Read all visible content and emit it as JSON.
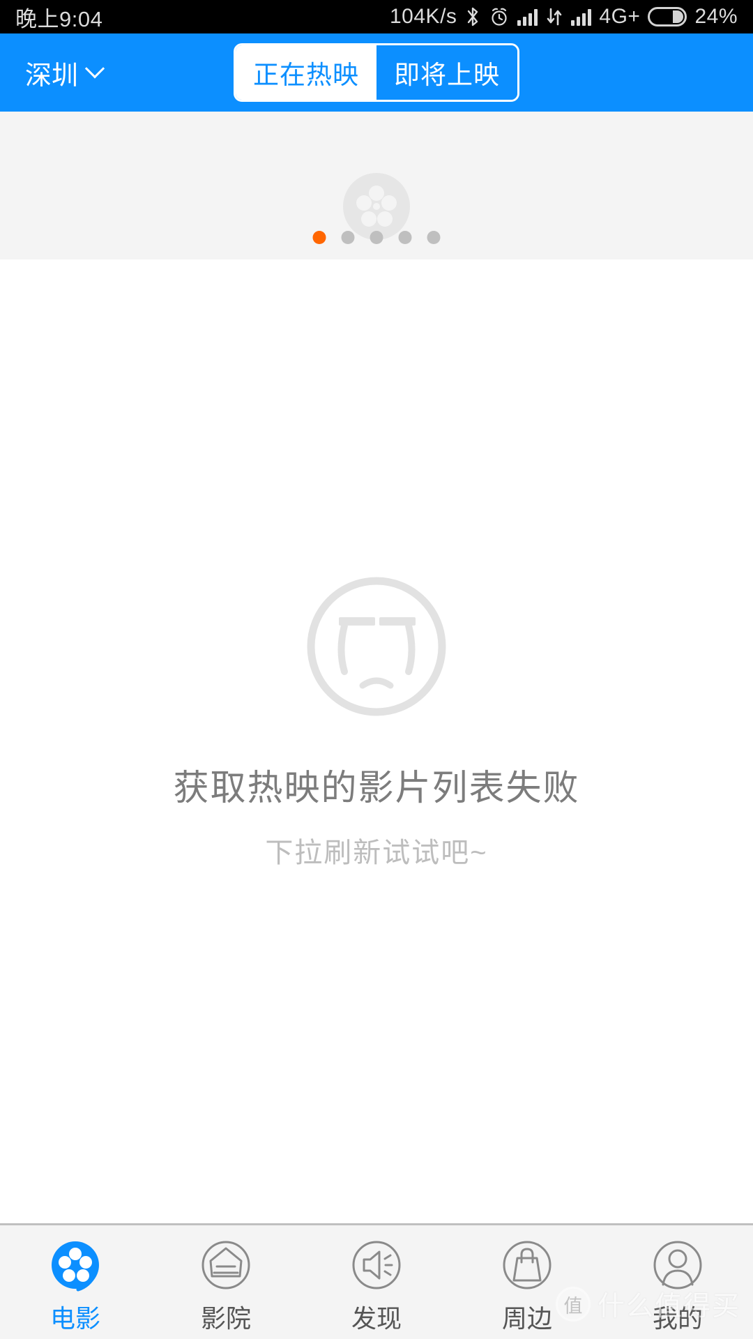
{
  "status_bar": {
    "clock": "晚上9:04",
    "net_speed": "104K/s",
    "bluetooth_icon": "bluetooth-icon",
    "alarm_icon": "alarm-clock-icon",
    "signal1_icon": "signal-bars-icon",
    "data_transfer_icon": "data-up-down-icon",
    "signal2_icon": "signal-bars-icon",
    "network_type": "4G+",
    "battery_icon": "battery-icon",
    "battery_percent": "24%"
  },
  "header": {
    "city": "深圳",
    "city_chevron_icon": "chevron-down-icon",
    "tabs": [
      {
        "label": "正在热映",
        "active": true
      },
      {
        "label": "即将上映",
        "active": false
      }
    ]
  },
  "banner": {
    "placeholder_icon": "film-reel-icon",
    "dot_count": 5,
    "active_dot_index": 0,
    "active_dot_color": "#FF6600",
    "inactive_dot_color": "#BFBFBF",
    "background_color": "#F4F4F4"
  },
  "empty_state": {
    "icon": "sad-face-icon",
    "title": "获取热映的影片列表失败",
    "subtitle": "下拉刷新试试吧~",
    "title_color": "#7C7C7C",
    "subtitle_color": "#BDBDBD"
  },
  "bottom_nav": {
    "active_color": "#0C8FFF",
    "inactive_color": "#555555",
    "items": [
      {
        "label": "电影",
        "icon": "film-reel-icon",
        "active": true
      },
      {
        "label": "影院",
        "icon": "cinema-seats-icon",
        "active": false
      },
      {
        "label": "发现",
        "icon": "megaphone-icon",
        "active": false
      },
      {
        "label": "周边",
        "icon": "shopping-bag-icon",
        "active": false
      },
      {
        "label": "我的",
        "icon": "user-profile-icon",
        "active": false
      }
    ]
  },
  "watermark": {
    "badge": "值",
    "text": "什么值得买"
  }
}
